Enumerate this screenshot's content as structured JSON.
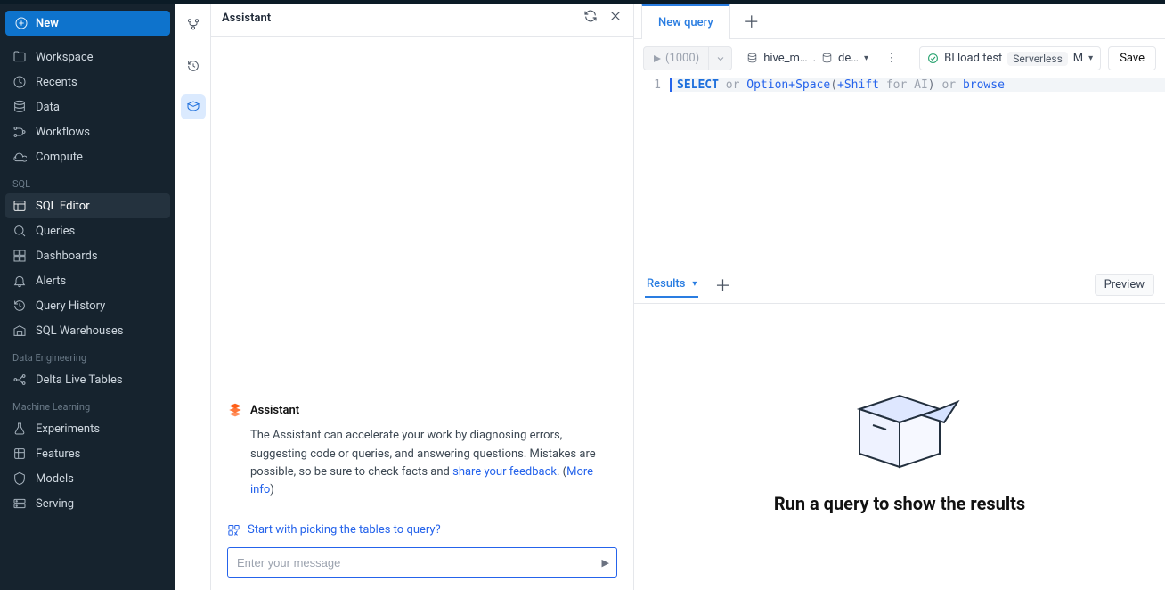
{
  "sidebar": {
    "newLabel": "New",
    "primary": [
      {
        "label": "Workspace",
        "name": "workspace"
      },
      {
        "label": "Recents",
        "name": "recents"
      },
      {
        "label": "Data",
        "name": "data"
      },
      {
        "label": "Workflows",
        "name": "workflows"
      },
      {
        "label": "Compute",
        "name": "compute"
      }
    ],
    "sections": {
      "sql": {
        "label": "SQL",
        "items": [
          {
            "label": "SQL Editor",
            "name": "sql-editor",
            "active": true
          },
          {
            "label": "Queries",
            "name": "queries"
          },
          {
            "label": "Dashboards",
            "name": "dashboards"
          },
          {
            "label": "Alerts",
            "name": "alerts"
          },
          {
            "label": "Query History",
            "name": "query-history"
          },
          {
            "label": "SQL Warehouses",
            "name": "sql-warehouses"
          }
        ]
      },
      "de": {
        "label": "Data Engineering",
        "items": [
          {
            "label": "Delta Live Tables",
            "name": "delta-live-tables"
          }
        ]
      },
      "ml": {
        "label": "Machine Learning",
        "items": [
          {
            "label": "Experiments",
            "name": "experiments"
          },
          {
            "label": "Features",
            "name": "features"
          },
          {
            "label": "Models",
            "name": "models"
          },
          {
            "label": "Serving",
            "name": "serving"
          }
        ]
      }
    }
  },
  "assistant": {
    "title": "Assistant",
    "blockTitle": "Assistant",
    "descPrefix": "The Assistant can accelerate your work by diagnosing errors, suggesting code or queries, and answering questions. Mistakes are possible, so be sure to check facts and ",
    "feedbackLink": "share your feedback",
    "afterFeedback": ". (",
    "moreInfoLink": "More info",
    "afterMoreInfo": ")",
    "hintText": "Start with picking the tables to query?",
    "placeholder": "Enter your message"
  },
  "editor": {
    "tabName": "New query",
    "runCount": "(1000)",
    "catalog": "hive_m…",
    "schemaDot": ". ",
    "schema": "de…",
    "cluster": {
      "name": "BI load test",
      "type": "Serverless",
      "size": "M"
    },
    "saveLabel": "Save",
    "code": {
      "lineNo": "1",
      "kwSelect": "SELECT",
      "or1": "or",
      "optSpace": "Option+Space",
      "paren1": "(",
      "shift": "+Shift",
      "forAI": " for AI",
      "paren2": ") ",
      "or2": "or",
      "browse": "browse"
    }
  },
  "results": {
    "tabLabel": "Results",
    "previewLabel": "Preview",
    "emptyTitle": "Run a query to show the results"
  }
}
